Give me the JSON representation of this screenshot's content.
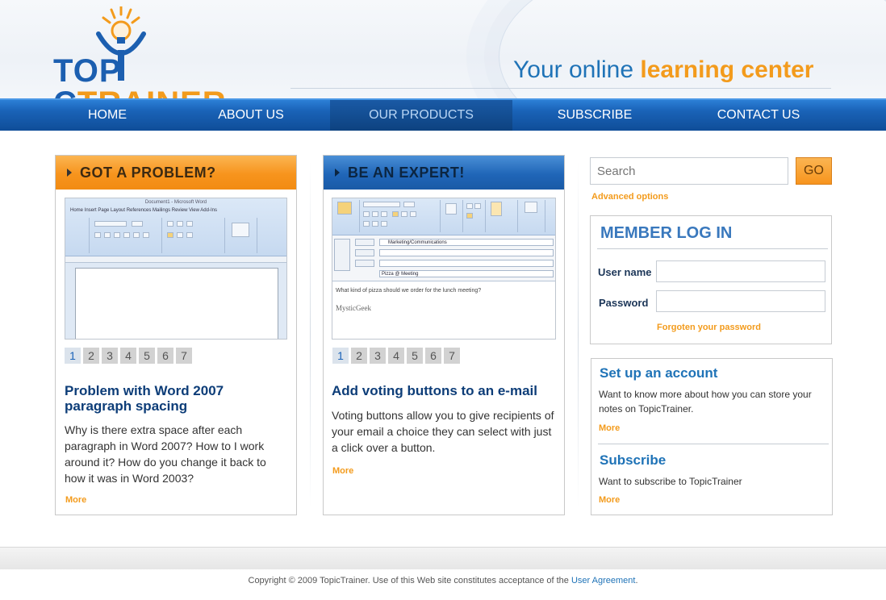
{
  "brand": {
    "logo_part1": "TOP",
    "logo_part2": "C",
    "logo_part3": "TRAINER",
    "tagline_part1": "Your online ",
    "tagline_part2": "learning center",
    "colors": {
      "blue": "#1c5fb0",
      "orange": "#f39b1c",
      "nav": "#1a63b8"
    }
  },
  "nav": {
    "items": [
      {
        "label": "HOME"
      },
      {
        "label": "ABOUT US"
      },
      {
        "label": "OUR PRODUCTS",
        "active": true
      },
      {
        "label": "SUBSCRIBE"
      },
      {
        "label": "CONTACT US"
      }
    ]
  },
  "panel1": {
    "heading": "GOT A PROBLEM?",
    "pages": [
      "1",
      "2",
      "3",
      "4",
      "5",
      "6",
      "7"
    ],
    "title": "Problem with Word 2007 paragraph spacing",
    "body": "Why is there extra space after each paragraph in Word 2007? How to I work around it? How do you change it back to how it was in Word 2003?",
    "more": "More",
    "shot_title": "Document1 - Microsoft Word",
    "shot_tabs": "Home   Insert   Page Layout   References   Mailings   Review   View   Add-Ins"
  },
  "panel2": {
    "heading": "BE AN EXPERT!",
    "pages": [
      "1",
      "2",
      "3",
      "4",
      "5",
      "6",
      "7"
    ],
    "title": "Add voting buttons to an e-mail",
    "body": "Voting buttons allow you to give recipients of your email a choice they can select with just a click over a button.",
    "more": "More",
    "shot_to": "Marketing/Communications",
    "shot_subject": "Pizza @ Meeting",
    "shot_message": "What kind of pizza should we order for the lunch meeting?",
    "shot_signature": "MysticGeek"
  },
  "search": {
    "placeholder": "Search",
    "go": "GO",
    "advanced": "Advanced options"
  },
  "login": {
    "title": "MEMBER LOG IN",
    "username_label": "User name",
    "password_label": "Password",
    "forgot": "Forgoten your password"
  },
  "info": {
    "account_title": "Set up an account",
    "account_body": "Want to know more about how you can store your notes on TopicTrainer.",
    "account_more": "More",
    "subscribe_title": "Subscribe",
    "subscribe_body": "Want to subscribe to TopicTrainer",
    "subscribe_more": "More"
  },
  "footer": {
    "text": "Copyright © 2009 TopicTrainer. Use of this Web site constitutes acceptance of the ",
    "link": "User Agreement",
    "end": "."
  }
}
